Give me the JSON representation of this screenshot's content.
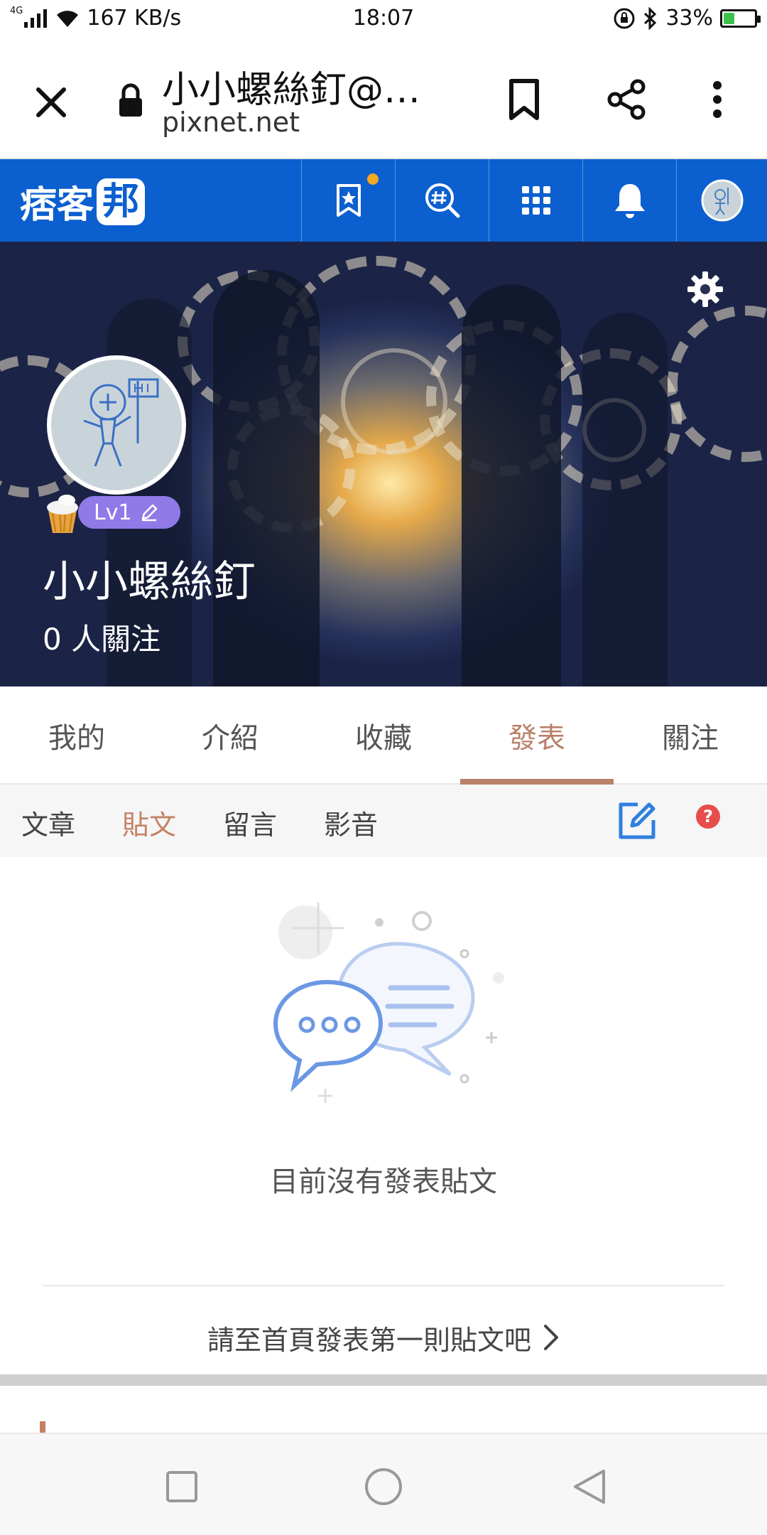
{
  "status_bar": {
    "network": "4G",
    "speed": "167 KB/s",
    "time": "18:07",
    "battery": "33%",
    "battery_level": 0.33
  },
  "browser": {
    "page_title": "小小螺絲釘@…",
    "url": "pixnet.net"
  },
  "pixnet_header": {
    "logo_text": "痞客",
    "logo_bubble": "邦",
    "accent_color": "#0b5fcf",
    "notification_dot_color": "#f5a623"
  },
  "profile": {
    "level": "Lv1",
    "name": "小小螺絲釘",
    "followers": "0 人關注"
  },
  "main_tabs": [
    {
      "label": "我的"
    },
    {
      "label": "介紹"
    },
    {
      "label": "收藏"
    },
    {
      "label": "發表",
      "active": true
    },
    {
      "label": "關注"
    }
  ],
  "sub_tabs": [
    {
      "label": "文章"
    },
    {
      "label": "貼文",
      "active": true
    },
    {
      "label": "留言"
    },
    {
      "label": "影音"
    }
  ],
  "help_label": "?",
  "empty_state": {
    "message": "目前沒有發表貼文",
    "cta": "請至首頁發表第一則貼文吧"
  },
  "theme": {
    "active_tab_color": "#b9816a",
    "help_color": "#e84d4d",
    "edit_icon_color": "#2f7fe0"
  }
}
